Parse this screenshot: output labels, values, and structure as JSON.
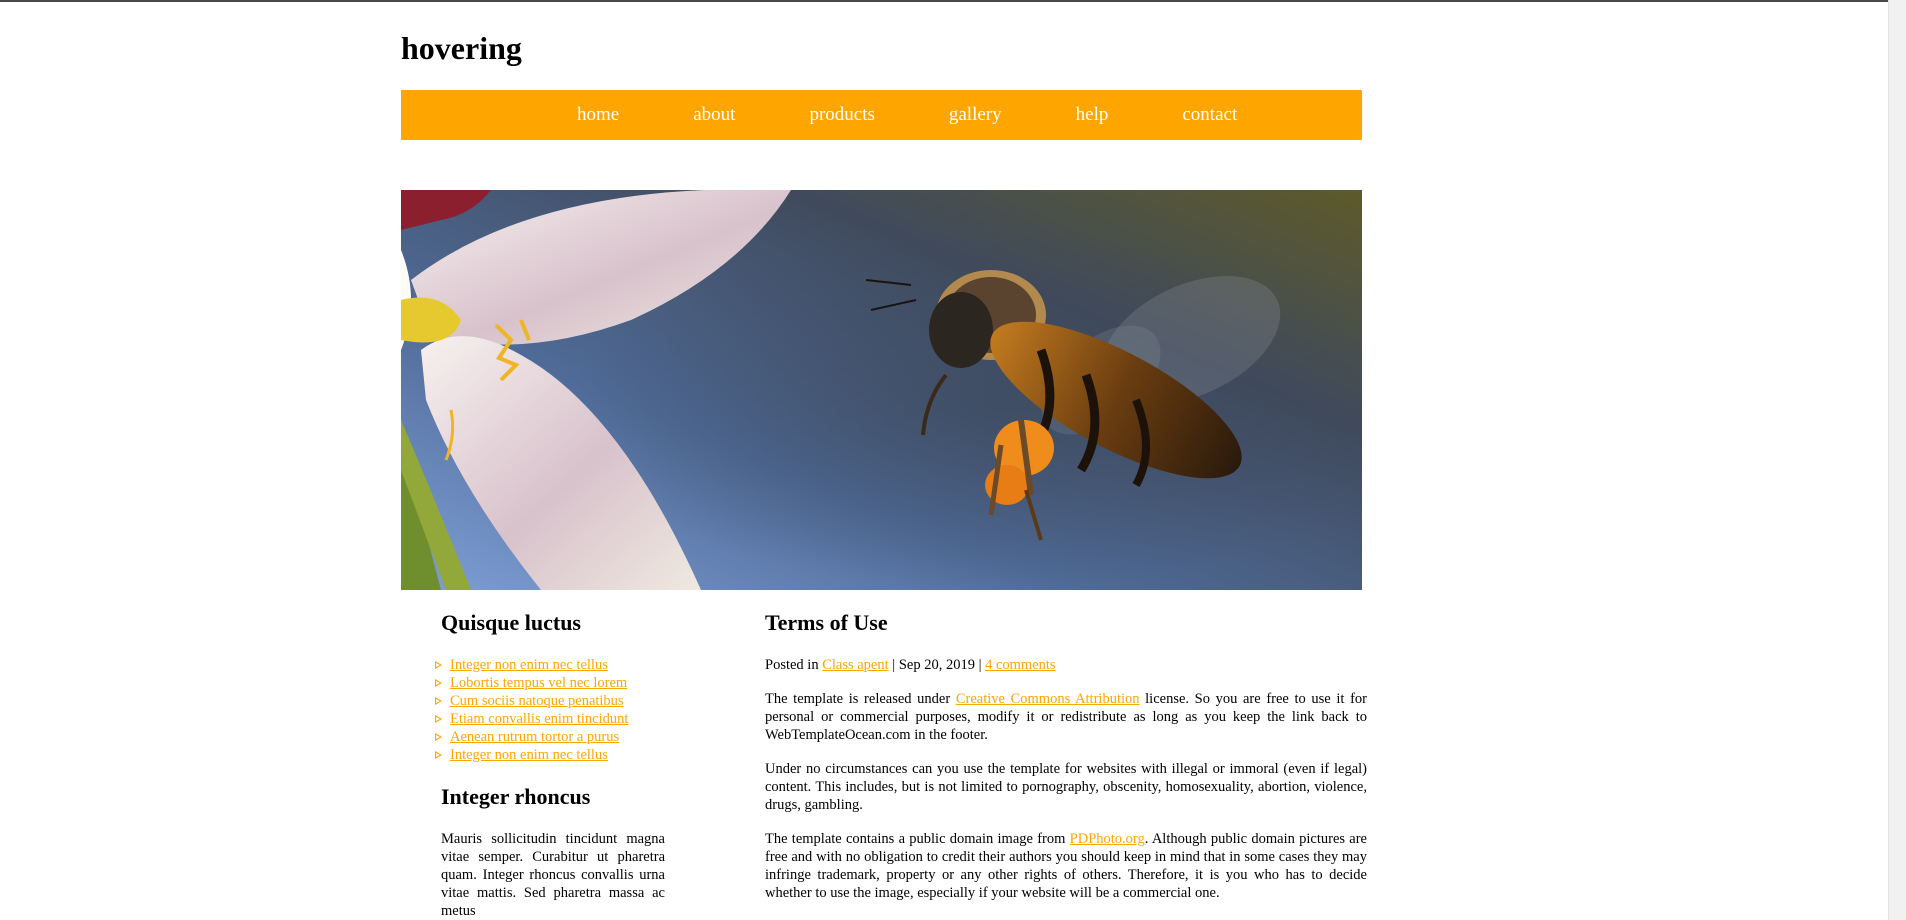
{
  "site": {
    "title": "hovering"
  },
  "nav": {
    "items": [
      "home",
      "about",
      "products",
      "gallery",
      "help",
      "contact"
    ]
  },
  "colors": {
    "accent": "#ffa500",
    "background": "#ffffff",
    "text": "#000000"
  },
  "sidebar": {
    "heading1": "Quisque luctus",
    "links": [
      "Integer non enim nec tellus",
      "Lobortis tempus vel nec lorem",
      "Cum sociis natoque penatibus",
      "Etiam convallis enim tincidunt",
      "Aenean rutrum tortor a purus",
      "Integer non enim nec tellus"
    ],
    "heading2": "Integer rhoncus",
    "text": "Mauris sollicitudin tincidunt magna vitae semper. Curabitur ut pharetra quam. Integer rhoncus convallis urna vitae mattis. Sed pharetra massa ac metus"
  },
  "post": {
    "title": "Terms of Use",
    "meta": {
      "posted_in": "Posted in ",
      "category": "Class apent",
      "sep1": " | ",
      "date": "Sep 20, 2019",
      "sep2": " | ",
      "comments": "4 comments"
    },
    "p1": {
      "before": "The template is released under ",
      "link": "Creative Commons Attribution",
      "after": " license. So you are free to use it for personal or commercial purposes, modify it or redistribute as long as you keep the link back to WebTemplateOcean.com in the footer."
    },
    "p2": "Under no circumstances can you use the template for websites with illegal or immoral (even if legal) content. This includes, but is not limited to pornography, obscenity, homosexuality, abortion, violence, drugs, gambling.",
    "p3": {
      "before": "The template contains a public domain image from ",
      "link": "PDPhoto.org",
      "after": ". Although public domain pictures are free and with no obligation to credit their authors you should keep in mind that in some cases they may infringe trademark, property or any other rights of others. Therefore, it is you who has to decide whether to use the image, especially if your website will be a commercial one."
    }
  },
  "hero": {
    "image": "bee-flower-photo"
  }
}
